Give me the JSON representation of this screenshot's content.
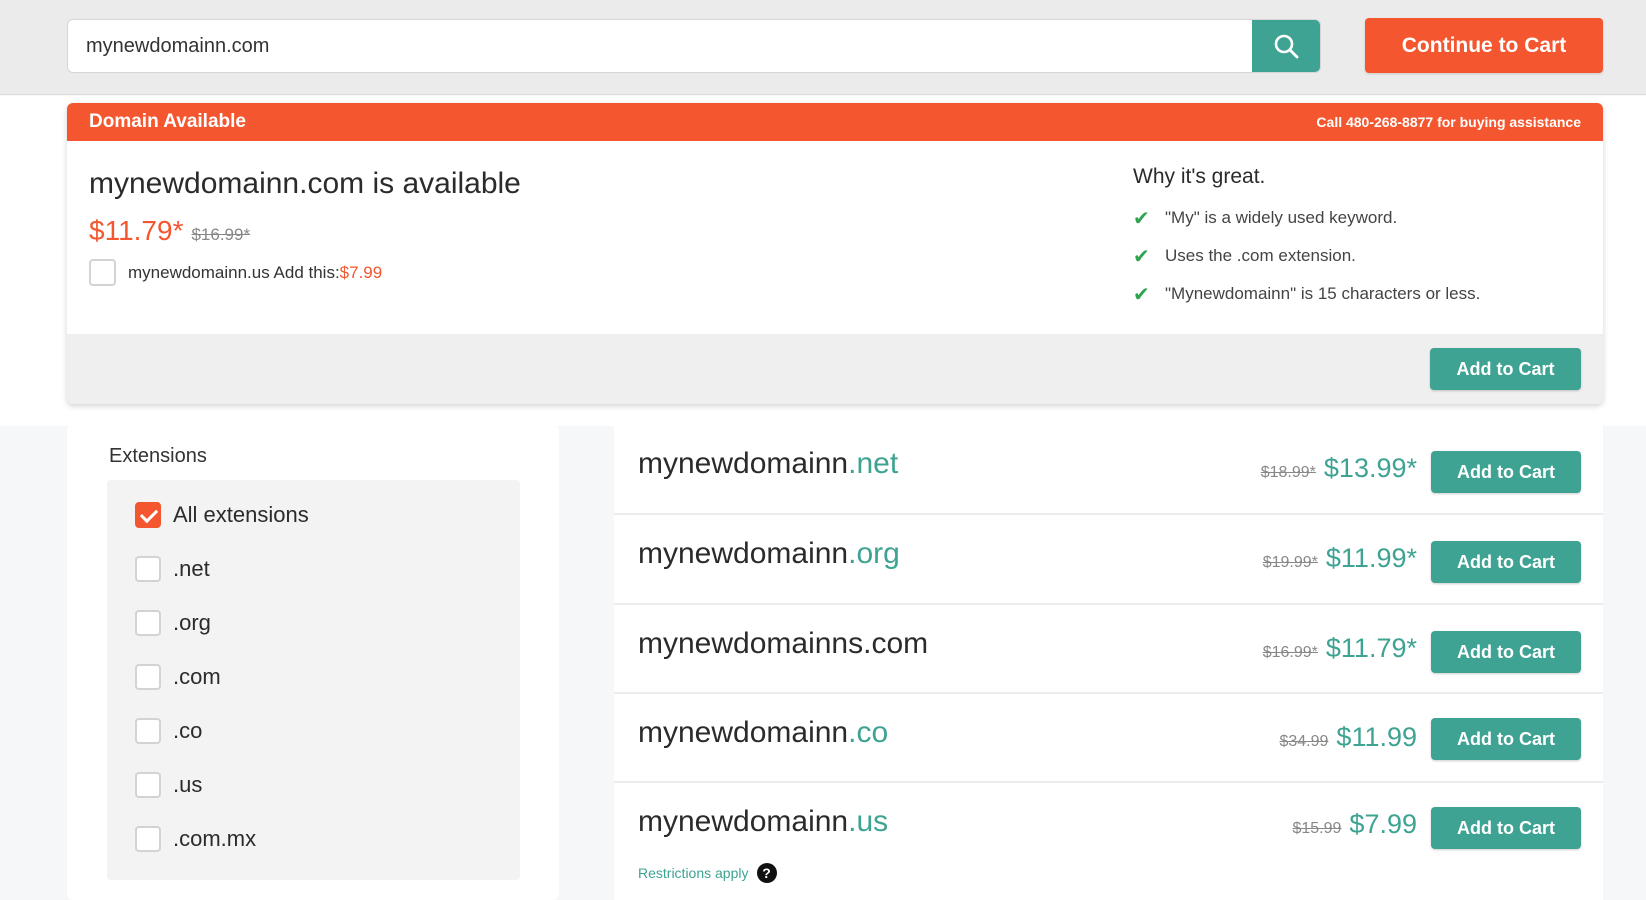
{
  "search": {
    "value": "mynewdomainn.com"
  },
  "header": {
    "continue_label": "Continue to Cart"
  },
  "available": {
    "banner_title": "Domain Available",
    "phone_text": "Call 480-268-8877 for buying assistance",
    "domain_text": "mynewdomainn.com is available",
    "price": "$11.79*",
    "old_price": "$16.99*",
    "addon_text": "mynewdomainn.us Add this:",
    "addon_price": "$7.99",
    "why_title": "Why it's great.",
    "reasons": [
      "\"My\" is a widely used keyword.",
      "Uses the .com extension.",
      "\"Mynewdomainn\" is 15 characters or less."
    ],
    "add_label": "Add to Cart"
  },
  "extensions": {
    "title": "Extensions",
    "items": [
      {
        "label": "All extensions",
        "checked": true
      },
      {
        "label": ".net",
        "checked": false
      },
      {
        "label": ".org",
        "checked": false
      },
      {
        "label": ".com",
        "checked": false
      },
      {
        "label": ".co",
        "checked": false
      },
      {
        "label": ".us",
        "checked": false
      },
      {
        "label": ".com.mx",
        "checked": false
      }
    ]
  },
  "results": [
    {
      "name": "mynewdomainn",
      "tld": ".net",
      "old_price": "$18.99*",
      "price": "$13.99*",
      "add_label": "Add to Cart"
    },
    {
      "name": "mynewdomainn",
      "tld": ".org",
      "old_price": "$19.99*",
      "price": "$11.99*",
      "add_label": "Add to Cart"
    },
    {
      "name": "mynewdomainns.com",
      "tld": "",
      "old_price": "$16.99*",
      "price": "$11.79*",
      "add_label": "Add to Cart"
    },
    {
      "name": "mynewdomainn",
      "tld": ".co",
      "old_price": "$34.99",
      "price": "$11.99",
      "add_label": "Add to Cart"
    },
    {
      "name": "mynewdomainn",
      "tld": ".us",
      "old_price": "$15.99",
      "price": "$7.99",
      "add_label": "Add to Cart",
      "note": "Restrictions apply"
    }
  ],
  "colors": {
    "brand_orange": "#f4572f",
    "brand_teal": "#3ea392",
    "check_green": "#2ea44f"
  },
  "icons": {
    "search": "search-icon",
    "check": "check-icon",
    "help": "question-circle-icon"
  }
}
